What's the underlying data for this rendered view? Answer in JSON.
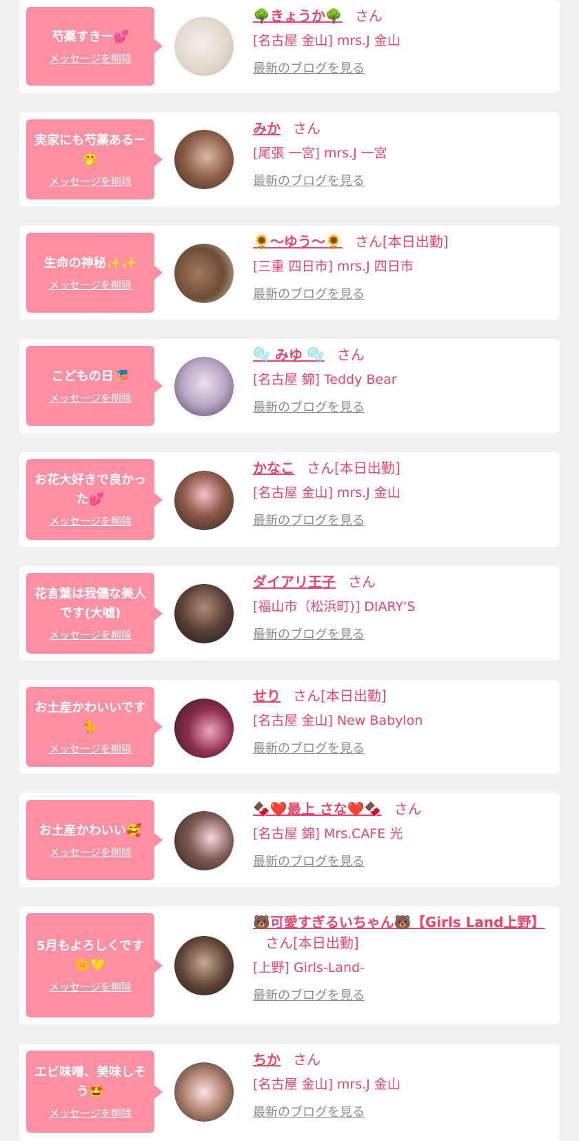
{
  "colors": {
    "background": "#f2f0f1",
    "card": "#ffffff",
    "bubble": "#fc8fa3",
    "accent_text": "#e8456b",
    "link_gray": "#8c8c8c"
  },
  "messages": [
    {
      "text": "芍薬すきー💕",
      "delete_label": "メッセージを削除",
      "name": "🌳きょうか🌳",
      "honorific": "さん",
      "status": "",
      "shop": "[名古屋 金山] mrs.J 金山",
      "blog_label": "最新のブログを見る"
    },
    {
      "text": "実家にも芍薬あるー🤭",
      "delete_label": "メッセージを削除",
      "name": "みか",
      "honorific": "さん",
      "status": "",
      "shop": "[尾張 一宮] mrs.J 一宮",
      "blog_label": "最新のブログを見る"
    },
    {
      "text": "生命の神秘✨✨",
      "delete_label": "メッセージを削除",
      "name": "🌻〜ゆう〜🌻",
      "honorific": "さん",
      "status": "[本日出勤]",
      "shop": "[三重 四日市] mrs.J 四日市",
      "blog_label": "最新のブログを見る"
    },
    {
      "text": "こどもの日🎏",
      "delete_label": "メッセージを削除",
      "name": "🫧 みゆ 🫧",
      "honorific": "さん",
      "status": "",
      "shop": "[名古屋 錦] Teddy Bear",
      "blog_label": "最新のブログを見る"
    },
    {
      "text": "お花大好きで良かった💕",
      "delete_label": "メッセージを削除",
      "name": "かなこ",
      "honorific": "さん",
      "status": "[本日出勤]",
      "shop": "[名古屋 金山] mrs.J 金山",
      "blog_label": "最新のブログを見る"
    },
    {
      "text": "花言葉は我儘な美人です(大嘘)",
      "delete_label": "メッセージを削除",
      "name": "ダイアリ王子",
      "honorific": "さん",
      "status": "",
      "shop": "[福山市（松浜町)] DIARY'S",
      "blog_label": "最新のブログを見る"
    },
    {
      "text": "お土産かわいいです🐈",
      "delete_label": "メッセージを削除",
      "name": "せり",
      "honorific": "さん",
      "status": "[本日出勤]",
      "shop": "[名古屋 金山] New Babylon",
      "blog_label": "最新のブログを見る"
    },
    {
      "text": "お土産かわいい🥰",
      "delete_label": "メッセージを削除",
      "name": "🍫❤️最上 さな❤️🍫",
      "honorific": "さん",
      "status": "",
      "shop": "[名古屋 錦] Mrs.CAFE 光",
      "blog_label": "最新のブログを見る"
    },
    {
      "text": "5月もよろしくです🌼💛",
      "delete_label": "メッセージを削除",
      "name": "🐻可愛すぎるいちゃん🐻【Girls Land上野】",
      "honorific": "さん",
      "status": "[本日出勤]",
      "shop": "[上野] Girls-Land-",
      "blog_label": "最新のブログを見る"
    },
    {
      "text": "エビ味噌、美味しそう🤩",
      "delete_label": "メッセージを削除",
      "name": "ちか",
      "honorific": "さん",
      "status": "",
      "shop": "[名古屋 金山] mrs.J 金山",
      "blog_label": "最新のブログを見る"
    }
  ]
}
